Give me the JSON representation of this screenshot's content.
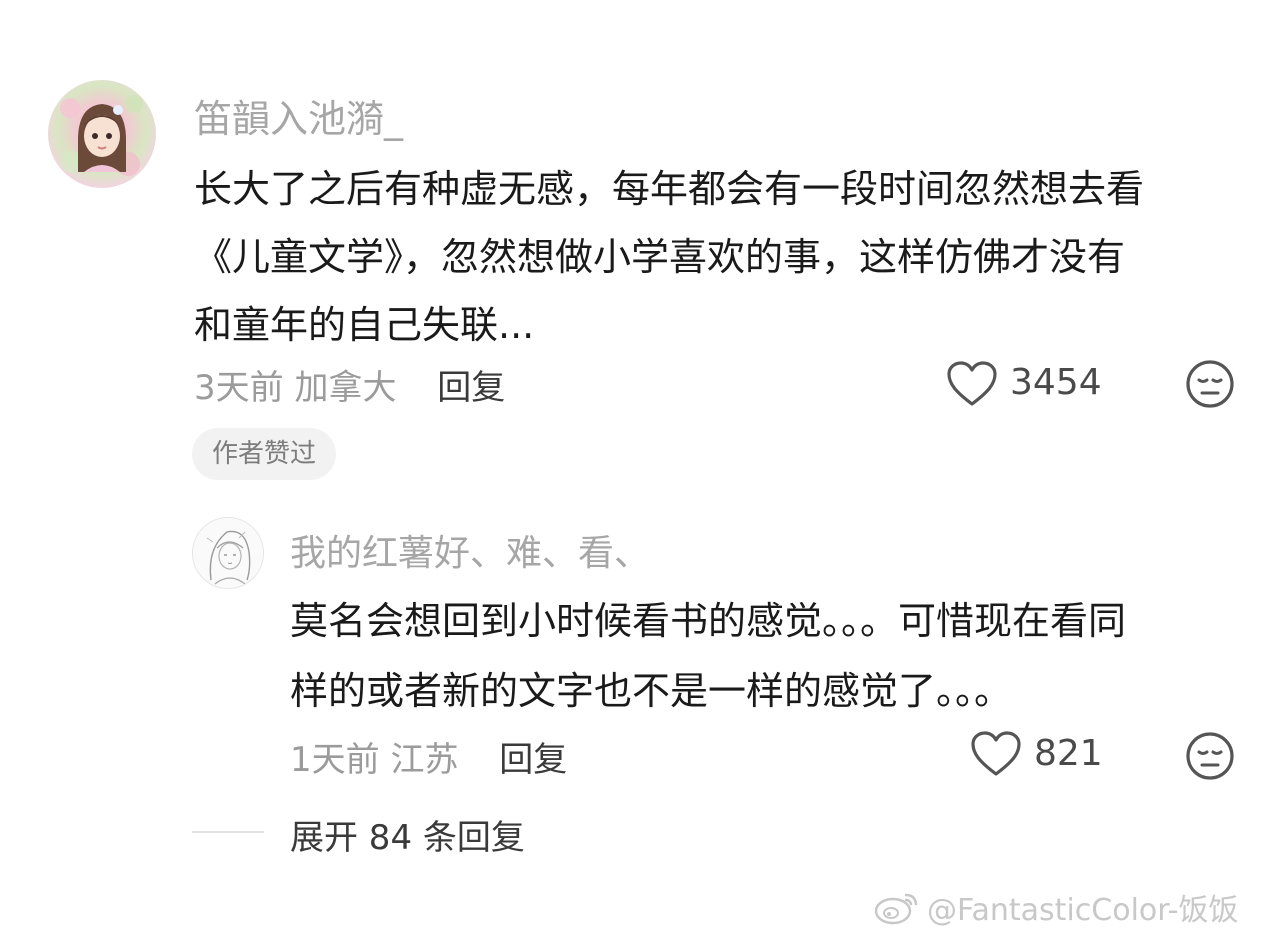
{
  "comment": {
    "username": "笛韻入池漪_",
    "text_lines": [
      "长大了之后有种虚无感，每年都会有一段时间忽然想去看",
      "《儿童文学》，忽然想做小学喜欢的事，这样仿佛才没有",
      "和童年的自己失联..."
    ],
    "time": "3天前",
    "location": "加拿大",
    "reply_label": "回复",
    "like_count": "3454",
    "badge": "作者赞过",
    "avatar_icon": "avatar-anime-girl-icon"
  },
  "reply": {
    "username": "我的红薯好、难、看、",
    "text_lines": [
      "莫名会想回到小时候看书的感觉。。。可惜现在看同",
      "样的或者新的文字也不是一样的感觉了。。。"
    ],
    "time": "1天前",
    "location": "江苏",
    "reply_label": "回复",
    "like_count": "821",
    "avatar_icon": "avatar-sketch-girl-icon"
  },
  "expand": {
    "label": "展开 84 条回复"
  },
  "watermark": {
    "text": "@FantasticColor-饭饭",
    "icon": "weibo-logo-icon"
  },
  "colors": {
    "username": "#a6a6a6",
    "body_text": "#1a1a1a",
    "meta_text": "#9b9b9b",
    "badge_bg": "#f2f2f2"
  }
}
